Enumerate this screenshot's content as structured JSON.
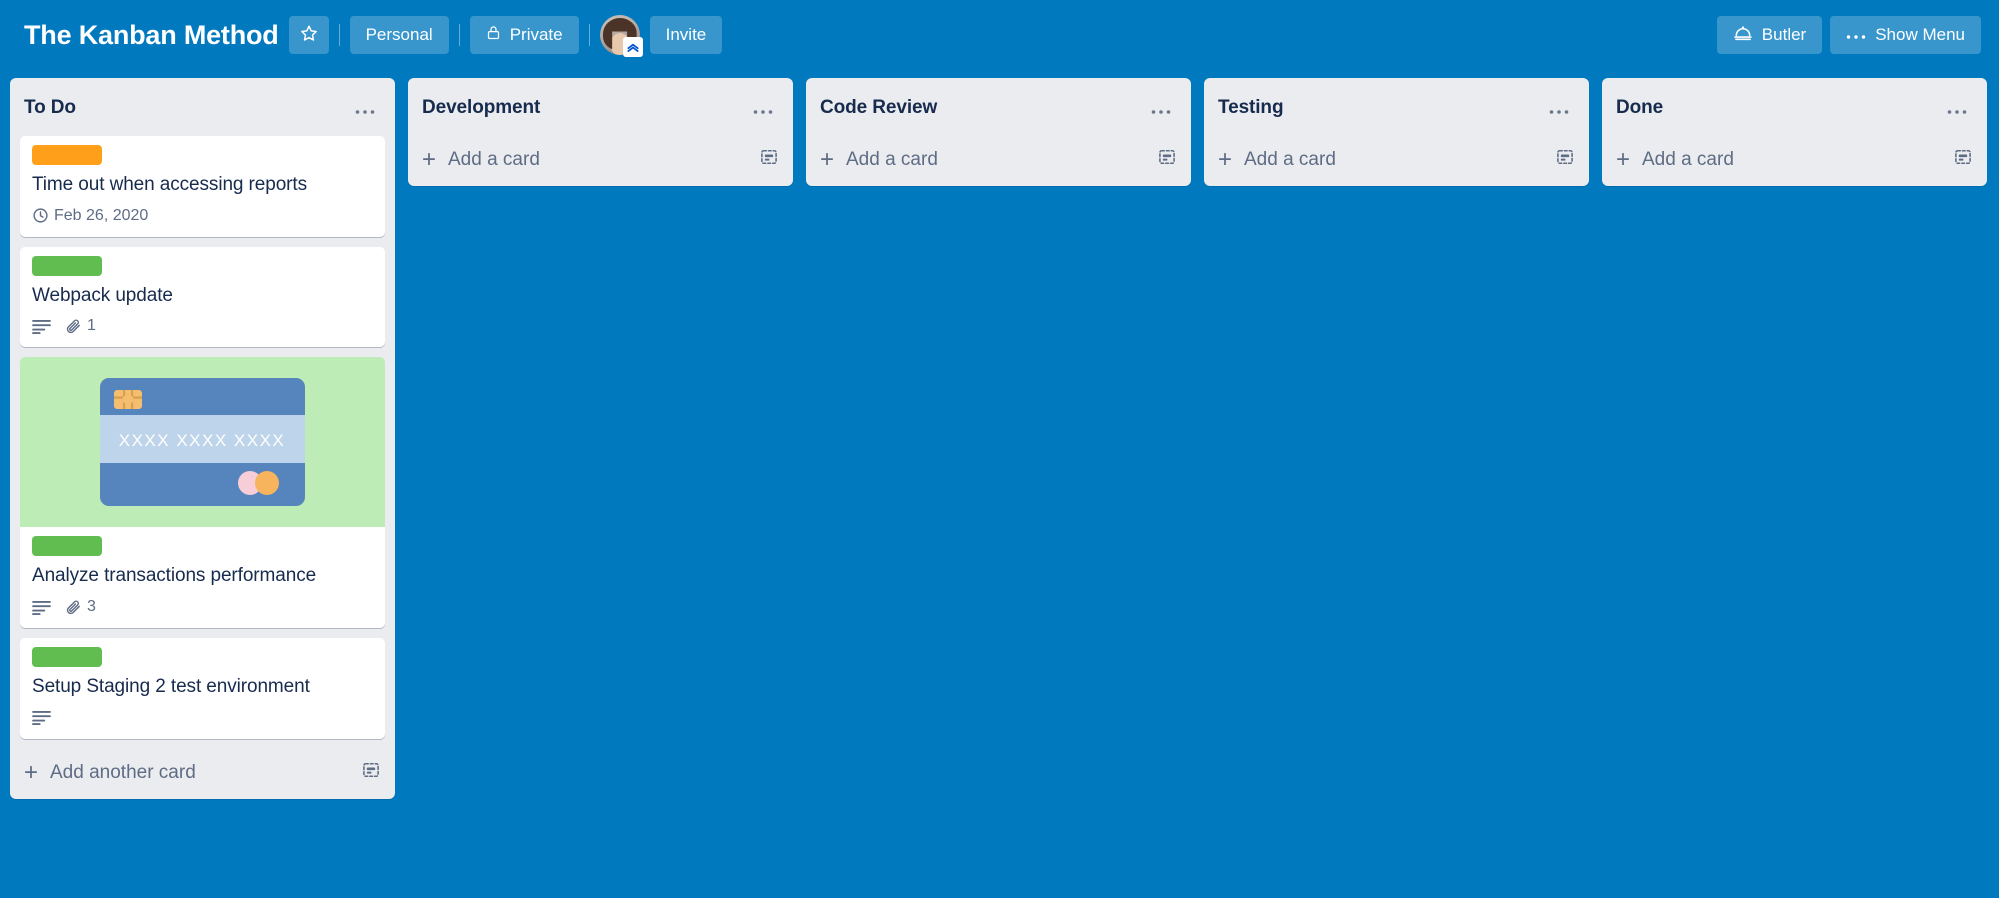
{
  "header": {
    "board_title": "The Kanban Method",
    "star_icon": "star-icon",
    "visibility_workspace": "Personal",
    "visibility_private": "Private",
    "private_icon": "lock-icon",
    "invite_label": "Invite",
    "avatar_name": "member-avatar",
    "butler_label": "Butler",
    "butler_icon": "butler-dome-icon",
    "show_menu_label": "Show Menu",
    "show_menu_icon": "ellipsis-icon",
    "background_color": "#0079BF"
  },
  "colors": {
    "board_bg": "#0079BF",
    "list_bg": "#EBECF0",
    "card_bg": "#FFFFFF",
    "text_dark": "#172B4D",
    "text_muted": "#5E6C84",
    "label_orange": "#FF9F1A",
    "label_green": "#61BD4F",
    "cover_green": "#BDECB6"
  },
  "lists": [
    {
      "title": "To Do",
      "menu_icon": "ellipsis-icon",
      "add_card_label": "Add another card",
      "add_card_plus": "+",
      "template_icon": "card-template-icon",
      "cards": [
        {
          "id": "card-time-out",
          "labels": [
            {
              "name": "orange-label",
              "color": "#FF9F1A"
            }
          ],
          "title": "Time out when accessing reports",
          "cover": null,
          "badges": [
            {
              "type": "due-date",
              "icon": "clock-icon",
              "text": "Feb 26, 2020"
            }
          ]
        },
        {
          "id": "card-webpack-update",
          "labels": [
            {
              "name": "green-label",
              "color": "#61BD4F"
            }
          ],
          "title": "Webpack update",
          "cover": null,
          "badges": [
            {
              "type": "description",
              "icon": "description-icon",
              "text": ""
            },
            {
              "type": "attachment",
              "icon": "paperclip-icon",
              "text": "1"
            }
          ]
        },
        {
          "id": "card-analyze-transactions",
          "labels": [
            {
              "name": "green-label",
              "color": "#61BD4F"
            }
          ],
          "title": "Analyze transactions performance",
          "cover": {
            "name": "credit-card-cover-image",
            "background": "#BDECB6",
            "card_number": "XXXX  XXXX  XXXX"
          },
          "badges": [
            {
              "type": "description",
              "icon": "description-icon",
              "text": ""
            },
            {
              "type": "attachment",
              "icon": "paperclip-icon",
              "text": "3"
            }
          ]
        },
        {
          "id": "card-setup-staging",
          "labels": [
            {
              "name": "green-label",
              "color": "#61BD4F"
            }
          ],
          "title": "Setup Staging 2 test environment",
          "cover": null,
          "badges": [
            {
              "type": "description",
              "icon": "description-icon",
              "text": ""
            }
          ]
        }
      ]
    },
    {
      "title": "Development",
      "menu_icon": "ellipsis-icon",
      "add_card_label": "Add a card",
      "add_card_plus": "+",
      "template_icon": "card-template-icon",
      "cards": []
    },
    {
      "title": "Code Review",
      "menu_icon": "ellipsis-icon",
      "add_card_label": "Add a card",
      "add_card_plus": "+",
      "template_icon": "card-template-icon",
      "cards": []
    },
    {
      "title": "Testing",
      "menu_icon": "ellipsis-icon",
      "add_card_label": "Add a card",
      "add_card_plus": "+",
      "template_icon": "card-template-icon",
      "cards": []
    },
    {
      "title": "Done",
      "menu_icon": "ellipsis-icon",
      "add_card_label": "Add a card",
      "add_card_plus": "+",
      "template_icon": "card-template-icon",
      "cards": []
    }
  ]
}
